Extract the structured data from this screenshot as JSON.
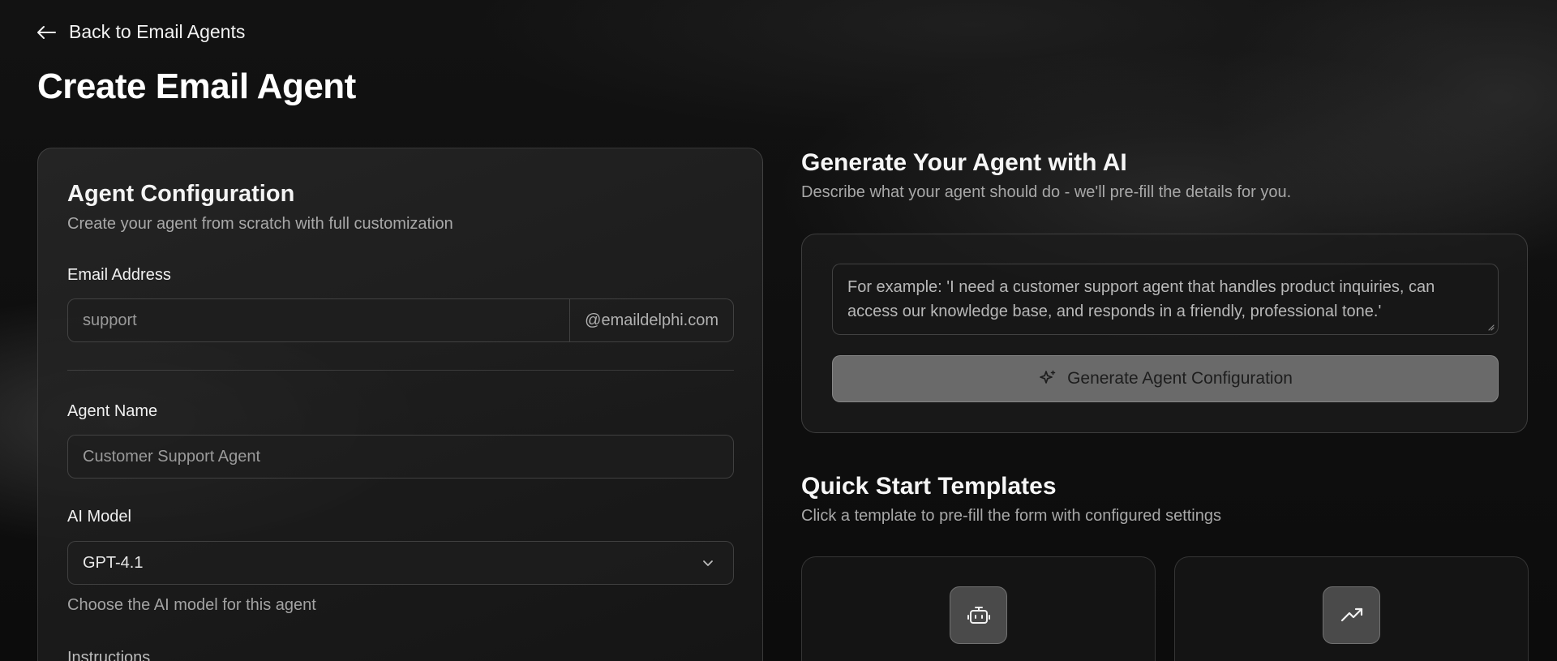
{
  "nav": {
    "back_label": "Back to Email Agents"
  },
  "page": {
    "title": "Create Email Agent"
  },
  "config": {
    "title": "Agent Configuration",
    "subtitle": "Create your agent from scratch with full customization",
    "email": {
      "label": "Email Address",
      "placeholder": "support",
      "domain_suffix": "@emaildelphi.com"
    },
    "name": {
      "label": "Agent Name",
      "placeholder": "Customer Support Agent"
    },
    "model": {
      "label": "AI Model",
      "selected": "GPT-4.1",
      "hint": "Choose the AI model for this agent"
    },
    "instructions": {
      "label": "Instructions"
    }
  },
  "generate": {
    "title": "Generate Your Agent with AI",
    "subtitle": "Describe what your agent should do - we'll pre-fill the details for you.",
    "prompt_placeholder": "For example: 'I need a customer support agent that handles product inquiries, can access our knowledge base, and responds in a friendly, professional tone.'",
    "button_label": "Generate Agent Configuration"
  },
  "templates": {
    "title": "Quick Start Templates",
    "subtitle": "Click a template to pre-fill the form with configured settings",
    "items": [
      {
        "icon": "bot-icon"
      },
      {
        "icon": "trending-up-icon"
      }
    ]
  },
  "colors": {
    "background": "#0b0b0b",
    "button_disabled": "#6a6a6a",
    "icon_tile": "#4a4a4a"
  }
}
